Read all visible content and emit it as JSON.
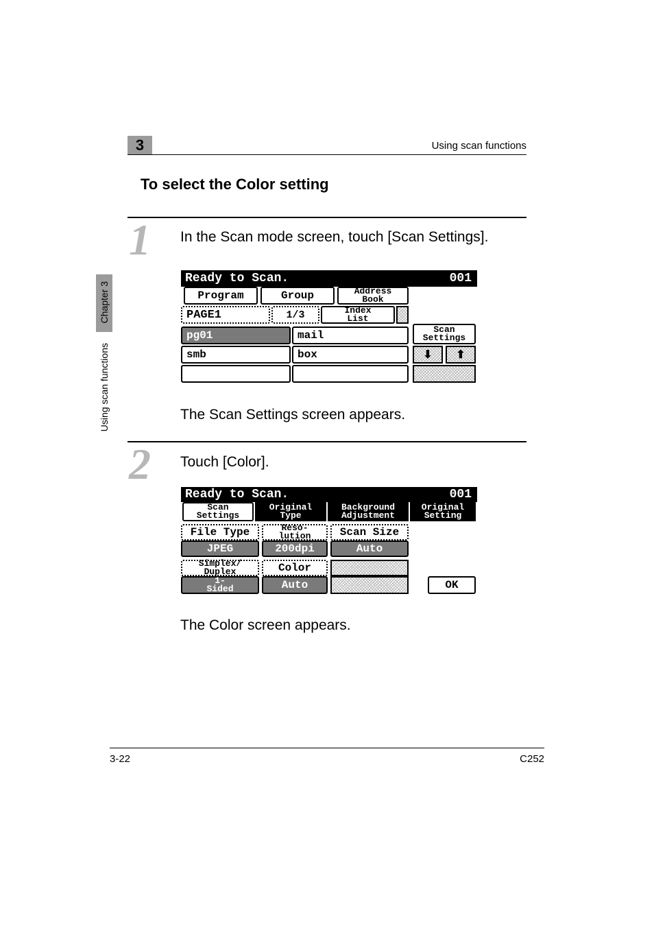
{
  "header": {
    "chapter_num": "3",
    "right": "Using scan functions"
  },
  "side": {
    "chapter": "Chapter 3",
    "section": "Using scan functions"
  },
  "heading": "To select the Color setting",
  "steps": {
    "s1": {
      "num": "1",
      "text": "In the Scan mode screen, touch [Scan Settings].",
      "after": "The Scan Settings screen appears."
    },
    "s2": {
      "num": "2",
      "text": "Touch [Color].",
      "after": "The Color screen appears."
    }
  },
  "screen1": {
    "status": "Ready to Scan.",
    "counter": "001",
    "tabs": {
      "program": "Program",
      "group": "Group",
      "address": "Address\nBook"
    },
    "page": {
      "label": "PAGE1",
      "idx": "1/3",
      "indexlist": "Index\nList"
    },
    "rows": [
      {
        "a": "pg01",
        "b": "mail"
      },
      {
        "a": "smb",
        "b": "box"
      },
      {
        "a": "",
        "b": ""
      }
    ],
    "side": {
      "scan_settings": "Scan\nSettings",
      "down": "↓",
      "up": "↑"
    }
  },
  "screen2": {
    "status": "Ready to Scan.",
    "counter": "001",
    "tabs": {
      "scan_settings": "Scan\nSettings",
      "orig_type": "Original\nType",
      "bg_adj": "Background\nAdjustment",
      "orig_set": "Original\nSetting"
    },
    "grid": {
      "filetype": {
        "label": "File Type",
        "value": "JPEG"
      },
      "reso": {
        "label": "Reso-\nlution",
        "value": "200dpi"
      },
      "scansize": {
        "label": "Scan Size",
        "value": "Auto"
      },
      "duplex": {
        "label": "Simplex/\nDuplex",
        "value": "1-\nSided"
      },
      "color": {
        "label": "Color",
        "value": "Auto"
      }
    },
    "ok": "OK"
  },
  "footer": {
    "left": "3-22",
    "right": "C252"
  }
}
